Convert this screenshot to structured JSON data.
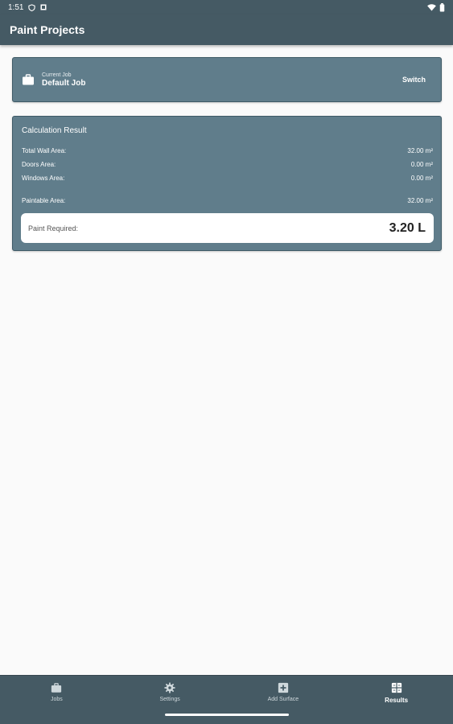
{
  "status_bar": {
    "time": "1:51"
  },
  "app_bar": {
    "title": "Paint Projects"
  },
  "job_card": {
    "caption": "Current Job",
    "job_name": "Default Job",
    "switch_label": "Switch",
    "icon": "briefcase-icon"
  },
  "result_card": {
    "title": "Calculation Result",
    "rows": [
      {
        "label": "Total Wall Area:",
        "value": "32.00 m²"
      },
      {
        "label": "Doors Area:",
        "value": "0.00 m²"
      },
      {
        "label": "Windows Area:",
        "value": "0.00 m²"
      },
      {
        "label": "Paintable Area:",
        "value": "32.00 m²"
      }
    ],
    "paint_required_label": "Paint Required:",
    "paint_required_value": "3.20 L"
  },
  "bottom_nav": {
    "items": [
      {
        "label": "Jobs",
        "icon": "briefcase-icon",
        "active": false
      },
      {
        "label": "Settings",
        "icon": "gear-icon",
        "active": false
      },
      {
        "label": "Add Surface",
        "icon": "add-box-icon",
        "active": false
      },
      {
        "label": "Results",
        "icon": "grid-icon",
        "active": true
      }
    ]
  },
  "colors": {
    "primary_dark": "#455a64",
    "card": "#607d8b",
    "background": "#fafafa"
  }
}
